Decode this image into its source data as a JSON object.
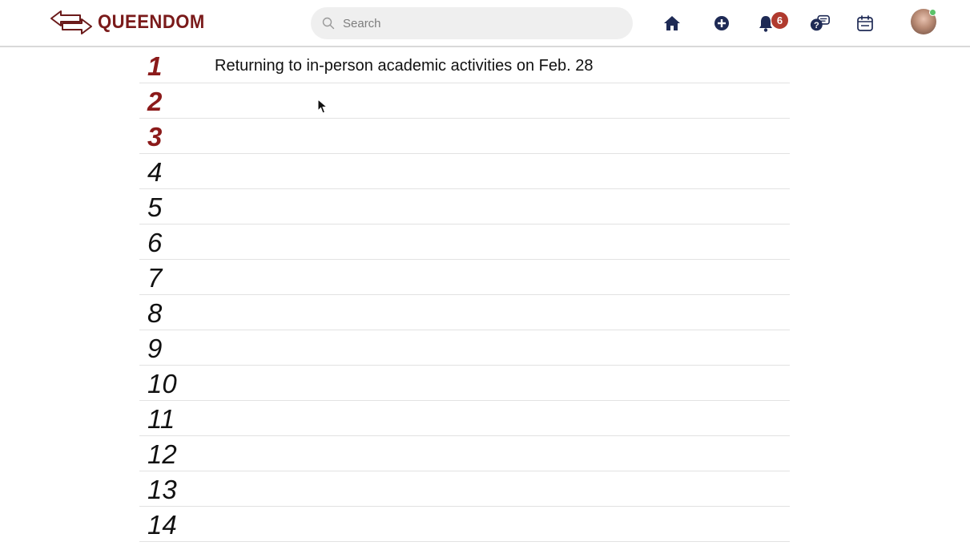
{
  "app": {
    "name": "QUEENDOM",
    "logo_icon": "double-arrow-logo-icon"
  },
  "search": {
    "placeholder": "Search",
    "value": ""
  },
  "nav": {
    "icons": [
      "home-icon",
      "add-circle-icon",
      "bell-icon",
      "chat-help-icon",
      "calendar-icon"
    ],
    "notifications_count": "6"
  },
  "colors": {
    "brand": "#7a1a1a",
    "top_rank": "#8b1a1a",
    "badge": "#b03a2e",
    "nav_icon": "#1e2a55"
  },
  "ranking": {
    "items": [
      {
        "rank": "1",
        "text": "Returning to in-person academic activities on Feb. 28"
      },
      {
        "rank": "2",
        "text": ""
      },
      {
        "rank": "3",
        "text": ""
      },
      {
        "rank": "4",
        "text": ""
      },
      {
        "rank": "5",
        "text": ""
      },
      {
        "rank": "6",
        "text": ""
      },
      {
        "rank": "7",
        "text": ""
      },
      {
        "rank": "8",
        "text": ""
      },
      {
        "rank": "9",
        "text": ""
      },
      {
        "rank": "10",
        "text": ""
      },
      {
        "rank": "11",
        "text": ""
      },
      {
        "rank": "12",
        "text": ""
      },
      {
        "rank": "13",
        "text": ""
      },
      {
        "rank": "14",
        "text": ""
      }
    ]
  }
}
